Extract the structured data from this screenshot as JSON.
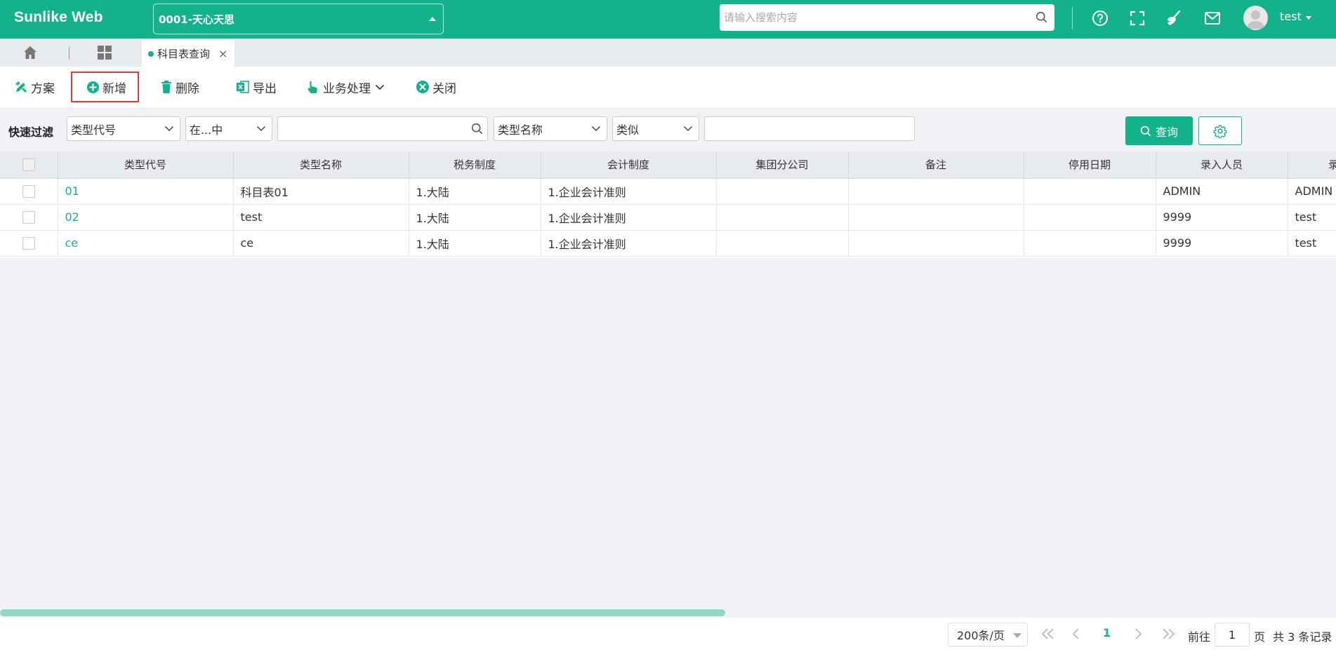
{
  "header": {
    "brand": "Sunlike Web",
    "company": "0001-天心天思",
    "search_placeholder": "请输入搜索内容",
    "user": "test",
    "bg_color": "#14b28a"
  },
  "tabs": {
    "active_label": "科目表查询"
  },
  "toolbar": {
    "scheme": "方案",
    "add": "新增",
    "delete": "删除",
    "export": "导出",
    "business": "业务处理",
    "close": "关闭"
  },
  "filter": {
    "label": "快速过滤",
    "field1": "类型代号",
    "op1": "在...中",
    "value1": "",
    "field2": "类型名称",
    "op2": "类似",
    "value2": "",
    "query_button": "查询"
  },
  "table": {
    "columns": [
      "类型代号",
      "类型名称",
      "税务制度",
      "会计制度",
      "集团分公司",
      "备注",
      "停用日期",
      "录入人员",
      "录入"
    ],
    "rows": [
      [
        "01",
        "科目表01",
        "1.大陆",
        "1.企业会计准则",
        "",
        "",
        "",
        "ADMIN",
        "ADMIN"
      ],
      [
        "02",
        "test",
        "1.大陆",
        "1.企业会计准则",
        "",
        "",
        "",
        "9999",
        "test"
      ],
      [
        "ce",
        "ce",
        "1.大陆",
        "1.企业会计准则",
        "",
        "",
        "",
        "9999",
        "test"
      ]
    ]
  },
  "pager": {
    "page_size": "200条/页",
    "current_page": "1",
    "goto_label": "前往",
    "goto_value": "1",
    "page_unit": "页",
    "total": "共 3 条记录"
  }
}
